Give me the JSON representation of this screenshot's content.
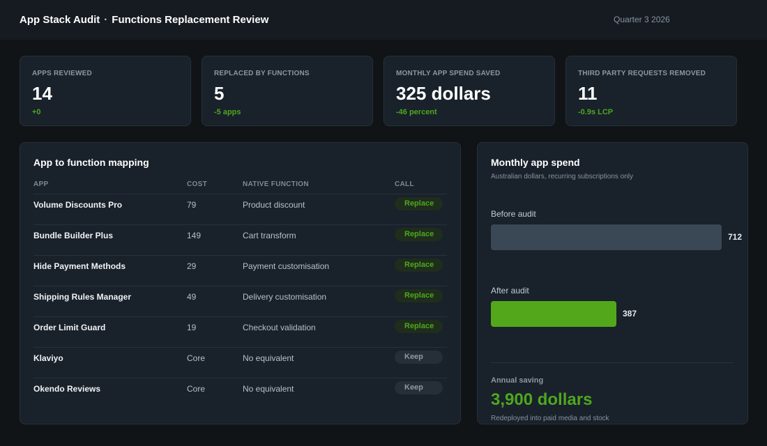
{
  "header": {
    "title": "App Stack Audit",
    "separator": "·",
    "subtitle": "Functions Replacement Review",
    "period": "Quarter 3 2026"
  },
  "kpis": [
    {
      "label": "APPS REVIEWED",
      "value": "14",
      "delta": "+0"
    },
    {
      "label": "REPLACED BY FUNCTIONS",
      "value": "5",
      "delta": "-5 apps"
    },
    {
      "label": "MONTHLY APP SPEND SAVED",
      "value": "325 dollars",
      "delta": "-46 percent"
    },
    {
      "label": "THIRD PARTY REQUESTS REMOVED",
      "value": "11",
      "delta": "-0.9s LCP"
    }
  ],
  "mapping": {
    "title": "App to function mapping",
    "columns": {
      "app": "APP",
      "cost": "COST",
      "fn": "NATIVE FUNCTION",
      "call": "CALL"
    },
    "rows": [
      {
        "app": "Volume Discounts Pro",
        "cost": "79",
        "fn": "Product discount",
        "call": "Replace",
        "kind": "replace"
      },
      {
        "app": "Bundle Builder Plus",
        "cost": "149",
        "fn": "Cart transform",
        "call": "Replace",
        "kind": "replace"
      },
      {
        "app": "Hide Payment Methods",
        "cost": "29",
        "fn": "Payment customisation",
        "call": "Replace",
        "kind": "replace"
      },
      {
        "app": "Shipping Rules Manager",
        "cost": "49",
        "fn": "Delivery customisation",
        "call": "Replace",
        "kind": "replace"
      },
      {
        "app": "Order Limit Guard",
        "cost": "19",
        "fn": "Checkout validation",
        "call": "Replace",
        "kind": "replace"
      },
      {
        "app": "Klaviyo",
        "cost": "Core",
        "fn": "No equivalent",
        "call": "Keep",
        "kind": "keep"
      },
      {
        "app": "Okendo Reviews",
        "cost": "Core",
        "fn": "No equivalent",
        "call": "Keep",
        "kind": "keep"
      }
    ]
  },
  "spend": {
    "title": "Monthly app spend",
    "subtitle": "Australian dollars, recurring subscriptions only",
    "annual_label": "Annual saving",
    "annual_value": "3,900 dollars",
    "annual_note": "Redeployed into paid media and stock"
  },
  "chart_data": {
    "type": "bar",
    "categories": [
      "Before audit",
      "After audit"
    ],
    "values": [
      712,
      387
    ],
    "colors": [
      "#3a4755",
      "#52a81a"
    ]
  },
  "colors": {
    "background": "#101417",
    "panel": "#19212a",
    "accent_green": "#4ea71f"
  }
}
